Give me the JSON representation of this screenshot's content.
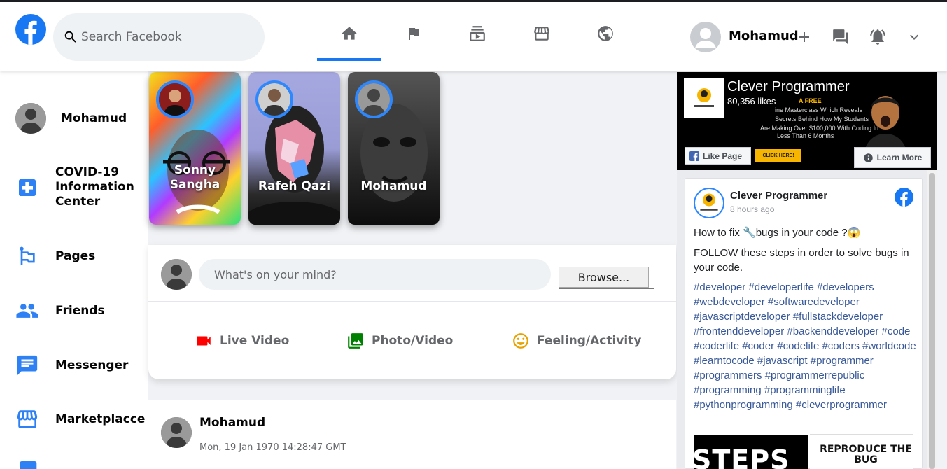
{
  "header": {
    "search_placeholder": "Search Facebook",
    "user_name": "Mohamud",
    "nav": [
      "home-icon",
      "flag-icon",
      "subscriptions-icon",
      "storefront-icon",
      "groups-icon"
    ],
    "actions": [
      "add-icon",
      "forum-icon",
      "notifications-icon",
      "expand-more-icon"
    ]
  },
  "sidebar": {
    "items": [
      {
        "label": "Mohamud",
        "icon": "avatar"
      },
      {
        "label": "COVID-19 Information Center",
        "icon": "local-hospital-icon"
      },
      {
        "label": "Pages",
        "icon": "emoji-flags-icon"
      },
      {
        "label": "Friends",
        "icon": "people-icon"
      },
      {
        "label": "Messenger",
        "icon": "chat-icon"
      },
      {
        "label": "Marketplacce",
        "icon": "storefront-icon"
      }
    ]
  },
  "stories": [
    {
      "name": "Sonny Sangha"
    },
    {
      "name": "Rafeh Qazi"
    },
    {
      "name": "Mohamud"
    }
  ],
  "composer": {
    "placeholder": "What's on your mind?",
    "browse_label": "Browse...",
    "options": [
      {
        "label": "Live Video",
        "icon": "videocam-icon",
        "color": "#ff0000"
      },
      {
        "label": "Photo/Video",
        "icon": "photo-library-icon",
        "color": "#008000"
      },
      {
        "label": "Feeling/Activity",
        "icon": "insert-emoticon-icon",
        "color": "#e8a200"
      }
    ]
  },
  "post": {
    "author": "Mohamud",
    "timestamp": "Mon, 19 Jan 1970 14:28:47 GMT"
  },
  "ad": {
    "page_name": "Clever Programmer",
    "likes": "80,356 likes",
    "lines": [
      "A FREE",
      "ine Masterclass Which Reveals",
      "Secrets Behind How My Students",
      "Are Making Over $100,000 With Coding In",
      "Less Than 6 Months"
    ],
    "like_page": "Like Page",
    "click_here": "CLICK HERE!",
    "learn_more": "Learn More"
  },
  "widget_post": {
    "author": "Clever Programmer",
    "time": "8 hours ago",
    "line1": "How to fix 🔧bugs in your code ?😱",
    "line2": "FOLLOW these steps in order to solve bugs in your code.",
    "hashtags": "#developer #developerlife #developers #webdeveloper #softwaredeveloper #javascriptdeveloper #fullstackdeveloper #frontenddeveloper #backenddeveloper #code #coderlife #coder #codelife #coders #worldcode #learntocode #javascript #programmer #programmers #programmerrepublic #programming #programminglife #pythonprogramming #cleverprogrammer",
    "thumb1": "STEPS",
    "thumb2": "REPRODUCE THE BUG"
  },
  "colors": {
    "brand": "#1877f2",
    "story_ring": "#2d88ff",
    "hashtag": "#385898"
  }
}
